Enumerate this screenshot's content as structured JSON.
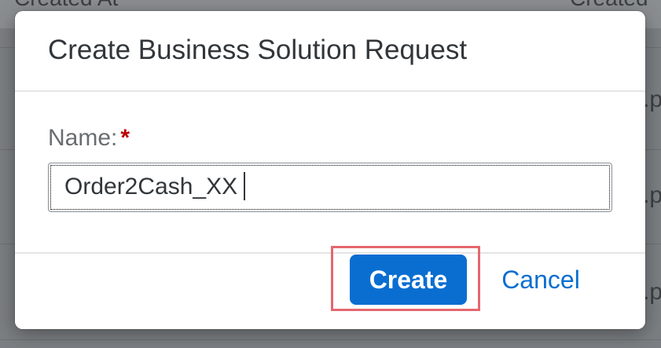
{
  "background_table": {
    "columns": [
      "Created At",
      "Created"
    ],
    "row_cells": [
      ".p",
      ".p",
      ".p"
    ]
  },
  "dialog": {
    "title": "Create Business Solution Request",
    "name_field": {
      "label": "Name:",
      "required_marker": "*",
      "value": "Order2Cash_XX"
    },
    "buttons": {
      "create_label": "Create",
      "cancel_label": "Cancel"
    }
  },
  "colors": {
    "accent": "#0a6ed1",
    "required": "#bb0000",
    "highlight": "#e5676f"
  }
}
